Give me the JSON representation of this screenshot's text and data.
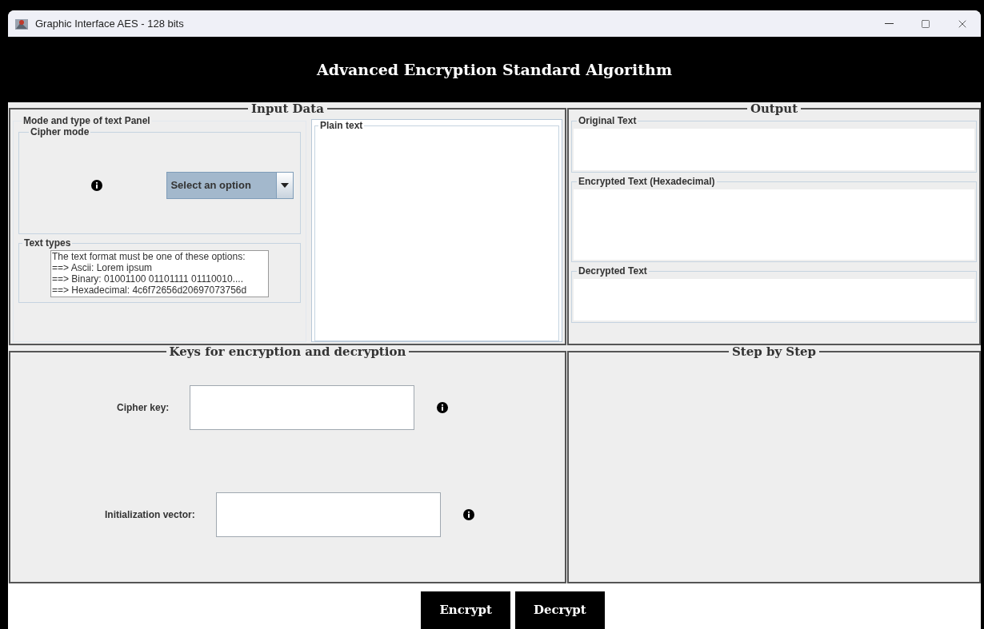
{
  "window": {
    "title": "Graphic Interface AES - 128 bits"
  },
  "header": {
    "title": "Advanced Encryption Standard Algorithm"
  },
  "input_data": {
    "title": "Input Data",
    "mode_panel": {
      "title": "Mode and type of text Panel",
      "cipher_mode": {
        "title": "Cipher mode",
        "dropdown": {
          "value": "Select an option"
        }
      },
      "text_types": {
        "title": "Text types",
        "lines": [
          "The text format must be one of these options:",
          "==> Ascii: Lorem ipsum",
          "==> Binary: 01001100 01101111 01110010....",
          "==> Hexadecimal: 4c6f72656d20697073756d"
        ]
      }
    },
    "plain_text": {
      "title": "Plain text"
    }
  },
  "output": {
    "title": "Output",
    "fields": [
      {
        "title": "Original Text"
      },
      {
        "title": "Encrypted Text (Hexadecimal)"
      },
      {
        "title": "Decrypted Text"
      }
    ]
  },
  "keys": {
    "title": "Keys for encryption and decryption",
    "fields": [
      {
        "label": "Cipher key:"
      },
      {
        "label": "Initialization vector:"
      }
    ]
  },
  "step_by_step": {
    "title": "Step by Step"
  },
  "buttons": [
    "Encrypt",
    "Decrypt"
  ]
}
